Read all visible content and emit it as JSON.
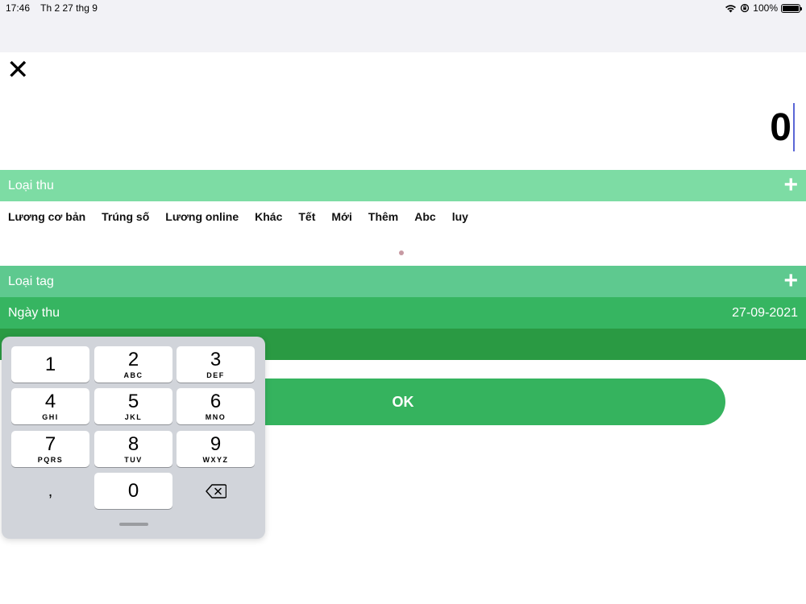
{
  "status_bar": {
    "time": "17:46",
    "date": "Th 2 27 thg 9",
    "battery": "100%"
  },
  "close": {
    "icon": "close-icon",
    "glyph": "✕"
  },
  "amount": {
    "value": "0"
  },
  "income_type": {
    "label": "Loại thu",
    "plus": "+"
  },
  "categories": [
    "Lương cơ bản",
    "Trúng số",
    "Lương online",
    "Khác",
    "Tết",
    "Mới",
    "Thêm",
    "Abc",
    "luy"
  ],
  "tag_type": {
    "label": "Loại tag",
    "plus": "+"
  },
  "income_date": {
    "label": "Ngày thu",
    "value": "27-09-2021"
  },
  "ok_button": {
    "label": "OK"
  },
  "keypad": {
    "keys": [
      {
        "num": "1",
        "letters": ""
      },
      {
        "num": "2",
        "letters": "ABC"
      },
      {
        "num": "3",
        "letters": "DEF"
      },
      {
        "num": "4",
        "letters": "GHI"
      },
      {
        "num": "5",
        "letters": "JKL"
      },
      {
        "num": "6",
        "letters": "MNO"
      },
      {
        "num": "7",
        "letters": "PQRS"
      },
      {
        "num": "8",
        "letters": "TUV"
      },
      {
        "num": "9",
        "letters": "WXYZ"
      },
      {
        "num": ",",
        "letters": ""
      },
      {
        "num": "0",
        "letters": ""
      }
    ],
    "backspace_icon": "backspace-icon"
  },
  "colors": {
    "light_green": "#7ddca4",
    "mid_green": "#5ec98f",
    "green": "#36b561",
    "dark_green": "#2a9a43",
    "button_green": "#35b35e"
  }
}
